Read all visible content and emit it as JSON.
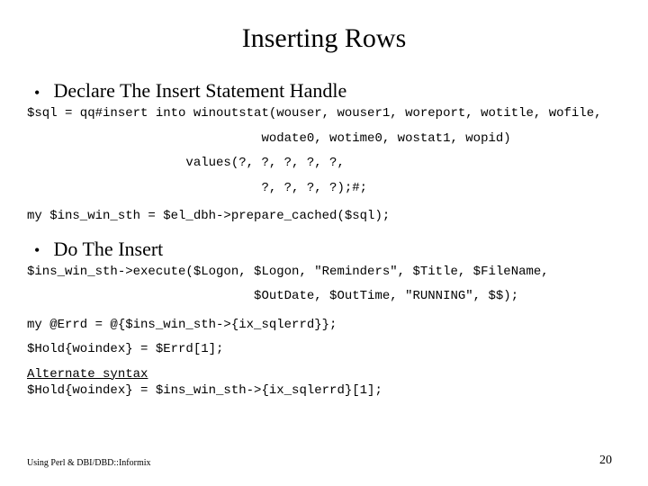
{
  "title": "Inserting Rows",
  "bullets": {
    "b1": "Declare The Insert Statement Handle",
    "b2": "Do The Insert"
  },
  "code": {
    "sql1": "$sql = qq#insert into winoutstat(wouser, wouser1, woreport, wotitle, wofile,",
    "sql2": "                               wodate0, wotime0, wostat1, wopid)",
    "sql3": "                     values(?, ?, ?, ?, ?,",
    "sql4": "                               ?, ?, ?, ?);#;",
    "prep": "my $ins_win_sth = $el_dbh->prepare_cached($sql);",
    "exec1": "$ins_win_sth->execute($Logon, $Logon, \"Reminders\", $Title, $FileName,",
    "exec2": "                              $OutDate, $OutTime, \"RUNNING\", $$);",
    "err1": "my @Errd = @{$ins_win_sth->{ix_sqlerrd}};",
    "err2": "$Hold{woindex} = $Errd[1];",
    "alt_label": "Alternate syntax",
    "alt1": "$Hold{woindex} = $ins_win_sth->{ix_sqlerrd}[1];"
  },
  "footer": {
    "left": "Using Perl & DBI/DBD::Informix",
    "right": "20"
  }
}
